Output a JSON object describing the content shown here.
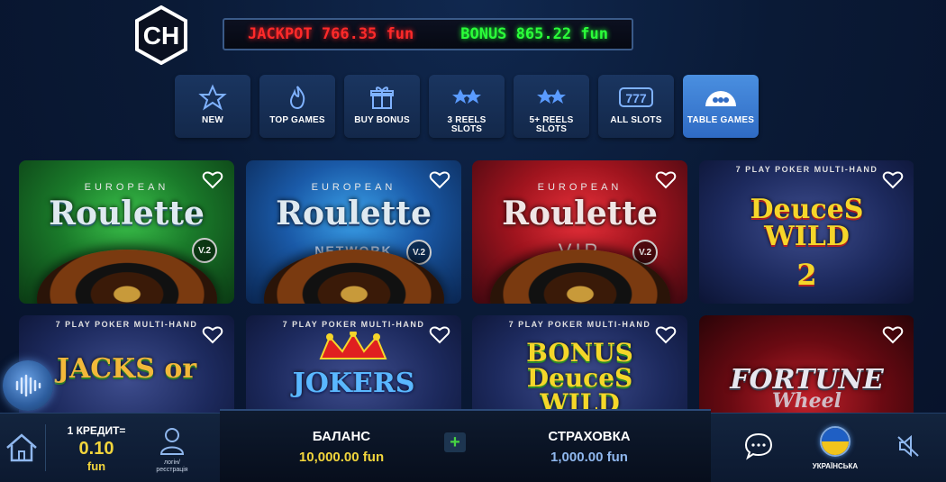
{
  "header": {
    "logo_text": "CH",
    "jackpot": "JACKPOT 766.35 fun",
    "bonus": "BONUS 865.22 fun"
  },
  "categories": [
    {
      "label": "NEW",
      "icon": "star-icon",
      "active": false
    },
    {
      "label": "TOP GAMES",
      "icon": "flame-icon",
      "active": false
    },
    {
      "label": "BUY BONUS",
      "icon": "gift-icon",
      "active": false
    },
    {
      "label": "3 REELS SLOTS",
      "icon": "two-stars-icon",
      "active": false
    },
    {
      "label": "5+ REELS SLOTS",
      "icon": "two-stars-icon",
      "active": false
    },
    {
      "label": "ALL SLOTS",
      "icon": "777-icon",
      "active": false
    },
    {
      "label": "TABLE GAMES",
      "icon": "table-games-icon",
      "active": true
    }
  ],
  "games": [
    {
      "top": "EUROPEAN",
      "title": "Roulette",
      "sub": "",
      "badge": "V.2",
      "theme": "green"
    },
    {
      "top": "EUROPEAN",
      "title": "Roulette",
      "sub": "NETWORK",
      "badge": "V.2",
      "theme": "blue"
    },
    {
      "top": "EUROPEAN",
      "title": "Roulette",
      "sub": "VIP",
      "badge": "V.2",
      "theme": "red"
    },
    {
      "top": "7 PLAY POKER MULTI-HAND",
      "title": "DeuceS WILD",
      "sub": "2",
      "badge": "",
      "theme": "navy"
    },
    {
      "top": "7 PLAY POKER MULTI-HAND",
      "title": "JACKS or",
      "sub": "",
      "badge": "",
      "theme": "navy"
    },
    {
      "top": "7 PLAY POKER MULTI-HAND",
      "title": "JOKERS",
      "sub": "",
      "badge": "",
      "theme": "navy"
    },
    {
      "top": "7 PLAY POKER MULTI-HAND",
      "title": "BONUS DeuceS WILD",
      "sub": "",
      "badge": "",
      "theme": "navy"
    },
    {
      "top": "",
      "title": "FORTUNE",
      "sub": "Wheel",
      "badge": "",
      "theme": "darkred"
    }
  ],
  "footer": {
    "credit_label": "1 КРЕДИТ=",
    "credit_value": "0.10",
    "credit_unit": "fun",
    "login_label_1": "логін/",
    "login_label_2": "реєстрація",
    "balance_label": "БАЛАНС",
    "balance_value": "10,000.00 fun",
    "plus": "+",
    "insurance_label": "СТРАХОВКА",
    "insurance_value": "1,000.00 fun",
    "language": "УКРАЇНСЬКА"
  },
  "colors": {
    "jackpot": "#ff2a2a",
    "bonus": "#2bff3a",
    "accent": "#f2d53c",
    "active_tab": "#3d7fd6"
  }
}
